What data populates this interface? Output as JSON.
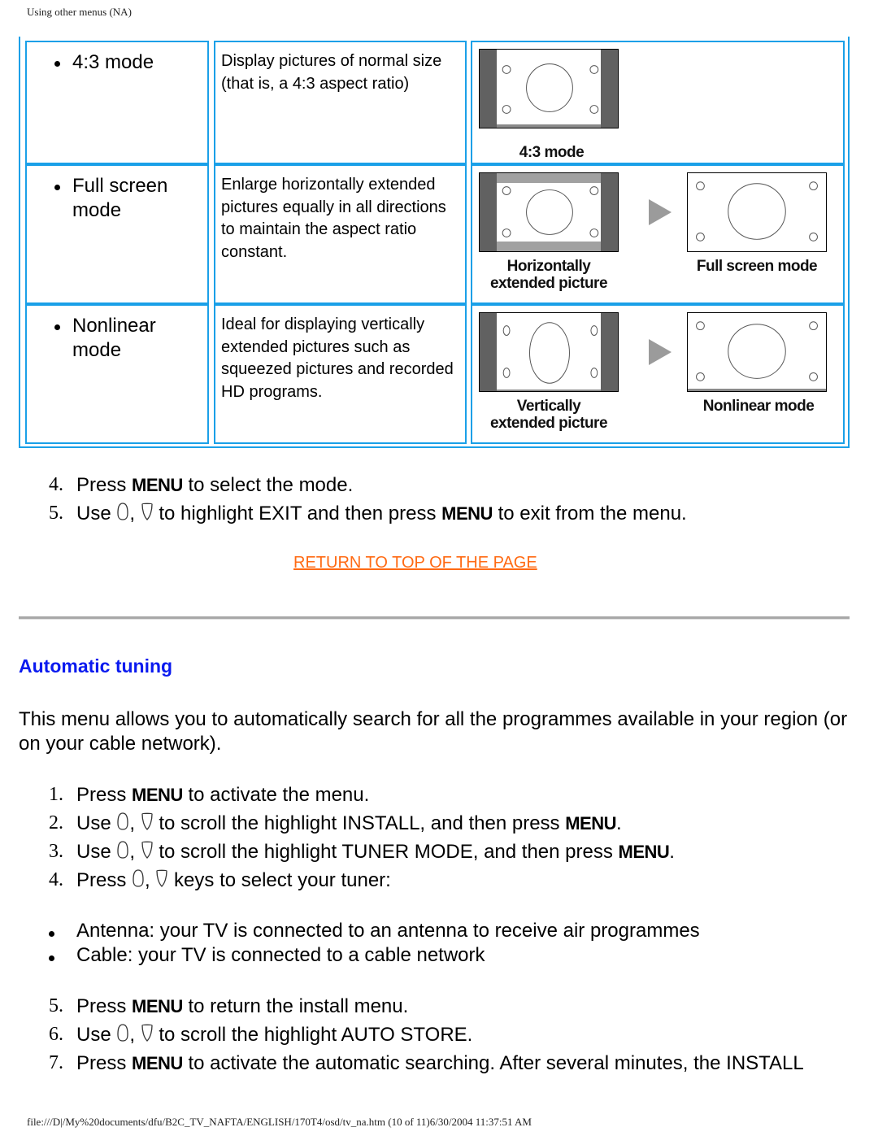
{
  "header": {
    "title": "Using other menus (NA)"
  },
  "modes_table": {
    "rows": [
      {
        "mode": "4:3 mode",
        "description": "Display pictures of normal size (that is, a 4:3 aspect ratio)",
        "images": [
          {
            "caption": "4:3 mode",
            "variant": "pillarbox"
          }
        ]
      },
      {
        "mode": "Full screen mode",
        "description": "Enlarge horizontally extended pictures equally in all directions to maintain the aspect ratio constant.",
        "images": [
          {
            "caption_line1": "Horizontally",
            "caption_line2": "extended picture",
            "variant": "windowbox"
          },
          {
            "caption": "Full screen mode",
            "variant": "full"
          }
        ]
      },
      {
        "mode": "Nonlinear mode",
        "description": "Ideal for displaying vertically extended pictures such as squeezed pictures and recorded HD programs.",
        "images": [
          {
            "caption_line1": "Vertically",
            "caption_line2": "extended picture",
            "variant": "vertical"
          },
          {
            "caption": "Nonlinear mode",
            "variant": "full"
          }
        ]
      }
    ],
    "arrow_icon": "right-triangle-arrow"
  },
  "mode_steps": [
    {
      "num": "4.",
      "pre": "Press",
      "key1": "MENU",
      "post": "to select the mode."
    },
    {
      "num": "5.",
      "pre": "Use",
      "mid": ",",
      "post": "to highlight EXIT and then press",
      "key": "MENU",
      "end": "to exit from the menu."
    }
  ],
  "return_link": "RETURN TO TOP OF THE PAGE",
  "section": {
    "title": "Automatic tuning",
    "intro": "This menu allows you to automatically search for all the programmes available in your region (or on your cable network).",
    "steps_a": [
      {
        "num": "1.",
        "pre": "Press",
        "key": "MENU",
        "post": "to activate the menu."
      },
      {
        "num": "2.",
        "pre": "Use",
        "mid": ",",
        "post": "to scroll the highlight INSTALL, and then press",
        "key": "MENU",
        "end": "."
      },
      {
        "num": "3.",
        "pre": "Use",
        "mid": ",",
        "post": "to scroll the highlight TUNER MODE, and then press",
        "key": "MENU",
        "end": "."
      },
      {
        "num": "4.",
        "pre": "Press",
        "mid": ",",
        "post": "keys to select your tuner:"
      }
    ],
    "bullets": [
      "Antenna: your TV is connected to an antenna to receive air programmes",
      "Cable: your TV is connected to a cable network"
    ],
    "steps_b": [
      {
        "num": "5.",
        "pre": "Press",
        "key": "MENU",
        "post": "to return the install menu."
      },
      {
        "num": "6.",
        "pre": "Use",
        "mid": ",",
        "post": "to scroll the highlight AUTO STORE."
      },
      {
        "num": "7.",
        "pre": "Press",
        "key": "MENU",
        "post": "to activate the automatic searching. After several minutes, the INSTALL"
      }
    ]
  },
  "icons": {
    "up_key": "up-cursor-key-icon",
    "down_key": "down-cursor-key-icon"
  },
  "footer": {
    "path": "file:///D|/My%20documents/dfu/B2C_TV_NAFTA/ENGLISH/170T4/osd/tv_na.htm (10 of 11)6/30/2004 11:37:51 AM"
  },
  "colors": {
    "table_border": "#1aa0e8",
    "link": "#ff6a13",
    "section_title": "#0a1aef"
  }
}
